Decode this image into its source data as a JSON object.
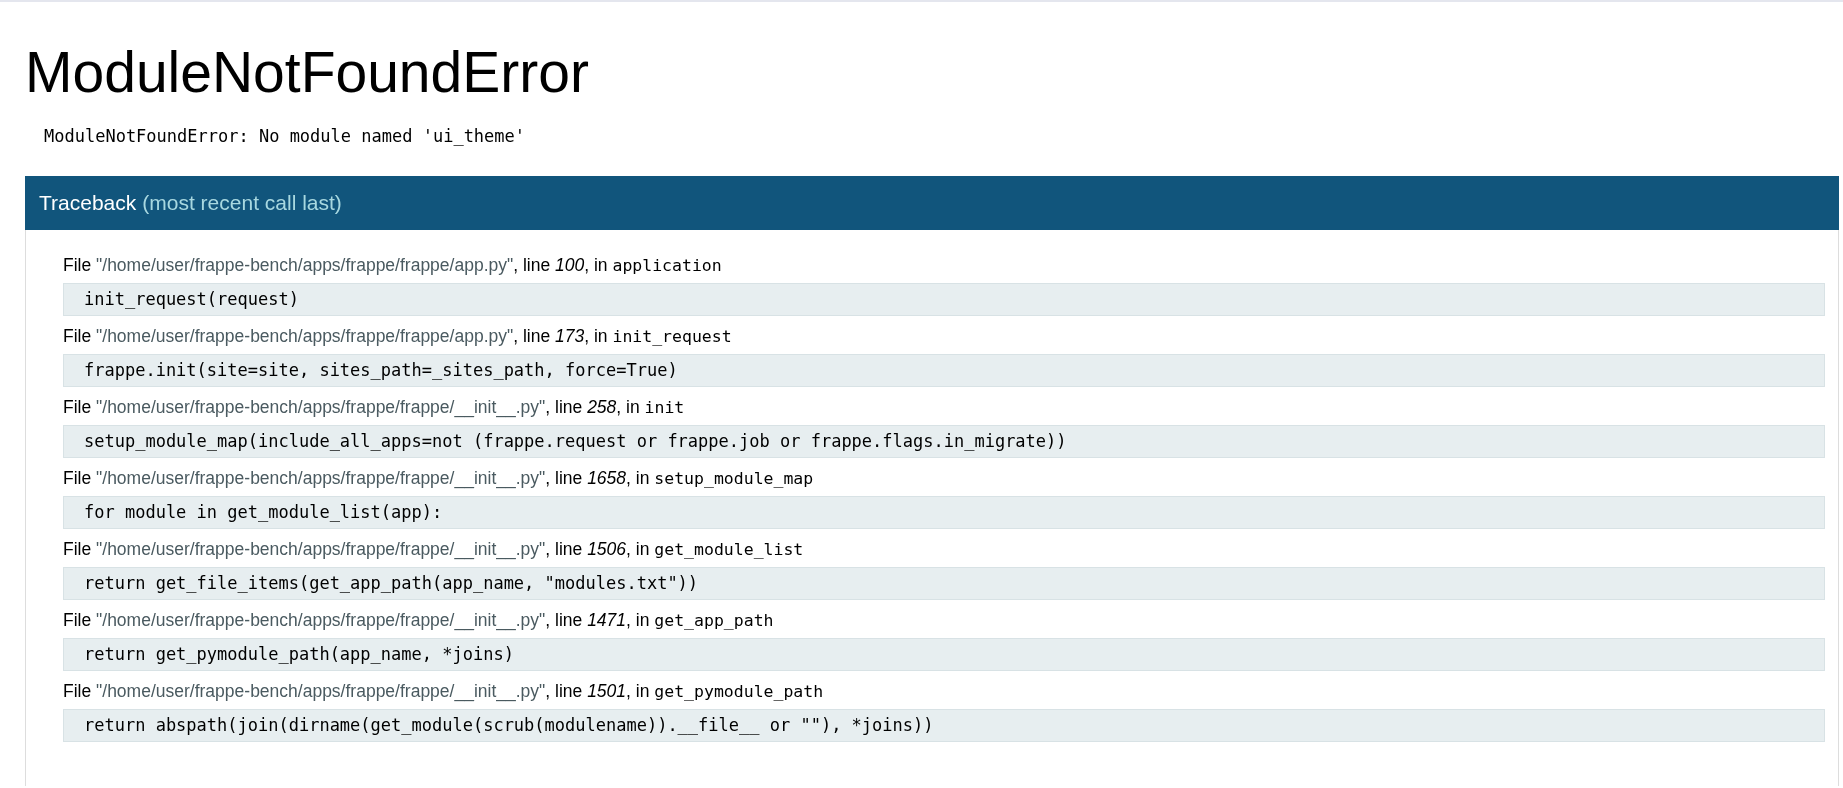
{
  "title": "ModuleNotFoundError",
  "message": "ModuleNotFoundError: No module named 'ui_theme'",
  "traceback": {
    "heading": "Traceback",
    "subheading": "(most recent call last)",
    "frames": [
      {
        "file_word": "File",
        "path": "\"/home/user/frappe-bench/apps/frappe/frappe/app.py\"",
        "line_word": ", line",
        "line": "100",
        "in_word": ", in",
        "func": "application",
        "code": "init_request(request)"
      },
      {
        "file_word": "File",
        "path": "\"/home/user/frappe-bench/apps/frappe/frappe/app.py\"",
        "line_word": ", line",
        "line": "173",
        "in_word": ", in",
        "func": "init_request",
        "code": "frappe.init(site=site, sites_path=_sites_path, force=True)"
      },
      {
        "file_word": "File",
        "path": "\"/home/user/frappe-bench/apps/frappe/frappe/__init__.py\"",
        "line_word": ", line",
        "line": "258",
        "in_word": ", in",
        "func": "init",
        "code": "setup_module_map(include_all_apps=not (frappe.request or frappe.job or frappe.flags.in_migrate))"
      },
      {
        "file_word": "File",
        "path": "\"/home/user/frappe-bench/apps/frappe/frappe/__init__.py\"",
        "line_word": ", line",
        "line": "1658",
        "in_word": ", in",
        "func": "setup_module_map",
        "code": "for module in get_module_list(app):"
      },
      {
        "file_word": "File",
        "path": "\"/home/user/frappe-bench/apps/frappe/frappe/__init__.py\"",
        "line_word": ", line",
        "line": "1506",
        "in_word": ", in",
        "func": "get_module_list",
        "code": "return get_file_items(get_app_path(app_name, \"modules.txt\"))"
      },
      {
        "file_word": "File",
        "path": "\"/home/user/frappe-bench/apps/frappe/frappe/__init__.py\"",
        "line_word": ", line",
        "line": "1471",
        "in_word": ", in",
        "func": "get_app_path",
        "code": "return get_pymodule_path(app_name, *joins)"
      },
      {
        "file_word": "File",
        "path": "\"/home/user/frappe-bench/apps/frappe/frappe/__init__.py\"",
        "line_word": ", line",
        "line": "1501",
        "in_word": ", in",
        "func": "get_pymodule_path",
        "code": "return abspath(join(dirname(get_module(scrub(modulename)).__file__ or \"\"), *joins))"
      }
    ]
  }
}
